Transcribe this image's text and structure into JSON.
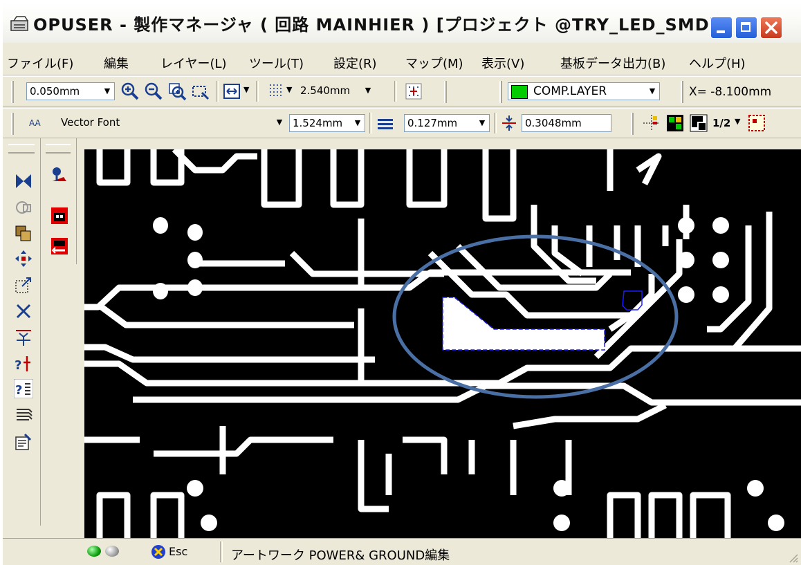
{
  "window": {
    "title": "OPUSER - 製作マネージャ ( 回路 MAINHIER ) [プロジェクト @TRY_LED_SMD]"
  },
  "menu": [
    "ファイル(F)",
    "編集",
    "レイヤー(L)",
    "ツール(T)",
    "設定(R)",
    "マップ(M)",
    "表示(V)",
    "基板データ出力(B)",
    "ヘルプ(H)"
  ],
  "toolbar1": {
    "grid_step": "0.050mm",
    "grid_pitch": "2.540mm",
    "layer": "COMP.LAYER",
    "layer_color": "#00cc00",
    "coord_x": "X= -8.100mm"
  },
  "toolbar2": {
    "font_prefix": "AA",
    "font": "Vector Font",
    "text_size": "1.524mm",
    "line_width": "0.127mm",
    "clearance": "0.3048mm",
    "ratio": "1/2"
  },
  "status": {
    "esc_label": "Esc",
    "mode_text": "アートワーク POWER& GROUND編集"
  },
  "colors": {
    "canvas_bg": "#000000",
    "trace": "#ffffff",
    "selection": "#1a1aff",
    "annotation_ellipse": "#4a6fa5"
  },
  "icons": {
    "title": "pcb-app-icon",
    "left_tools": [
      "select-icon",
      "rotate-icon",
      "copy-icon",
      "move-icon",
      "resize-icon",
      "delete-icon",
      "align-icon",
      "probe-icon",
      "query-icon",
      "pattern-icon",
      "properties-icon"
    ]
  }
}
